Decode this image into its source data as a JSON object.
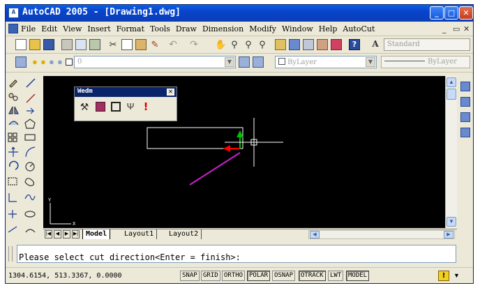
{
  "window": {
    "title": "AutoCAD 2005 - [Drawing1.dwg]",
    "app_icon_glyph": "A",
    "minimize_glyph": "_",
    "maximize_glyph": "□",
    "close_glyph": "✕"
  },
  "menubar": {
    "items": [
      "File",
      "Edit",
      "View",
      "Insert",
      "Format",
      "Tools",
      "Draw",
      "Dimension",
      "Modify",
      "Window",
      "Help",
      "AutoCut"
    ],
    "doc_controls": [
      "_",
      "▭",
      "✕"
    ]
  },
  "toolbar_standard": {
    "text_style_value": "Standard",
    "icons": [
      "new-icon",
      "open-icon",
      "save-icon",
      "plot-icon",
      "plot-preview-icon",
      "publish-icon",
      "cut-icon",
      "copy-icon",
      "paste-icon",
      "match-properties-icon",
      "undo-icon",
      "redo-icon",
      "pan-icon",
      "zoom-realtime-icon",
      "zoom-window-icon",
      "zoom-previous-icon",
      "properties-icon",
      "design-center-icon",
      "tool-palettes-icon",
      "sheet-set-icon",
      "markup-icon",
      "help-icon",
      "text-style-icon"
    ]
  },
  "toolbar_layers": {
    "layer_value": "0",
    "color_value": "ByLayer",
    "linetype_value": "ByLayer"
  },
  "floating_panel": {
    "title": "Wedm",
    "close_glyph": "✕",
    "icons": [
      "wire-path-icon",
      "square-tool-icon",
      "frame-tool-icon",
      "cutter-tool-icon",
      "alert-icon"
    ]
  },
  "layout_tabs": {
    "nav": [
      "|◀",
      "◀",
      "▶",
      "▶|"
    ],
    "tabs": [
      "Model",
      "Layout1",
      "Layout2"
    ],
    "active": "Model"
  },
  "ucs": {
    "y_label": "Y",
    "x_label": "X"
  },
  "command_line": {
    "text": "Please select cut direction<Enter = finish>:"
  },
  "status": {
    "coords": "1304.6154, 513.3367, 0.0000",
    "toggles": [
      {
        "label": "SNAP",
        "on": false
      },
      {
        "label": "GRID",
        "on": false
      },
      {
        "label": "ORTHO",
        "on": false
      },
      {
        "label": "POLAR",
        "on": true
      },
      {
        "label": "OSNAP",
        "on": false
      },
      {
        "label": "OTRACK",
        "on": true
      },
      {
        "label": "LWT",
        "on": false
      },
      {
        "label": "MODEL",
        "on": true
      }
    ]
  },
  "colors": {
    "canvas_bg": "#000000",
    "title_bar": "#0a4fd6",
    "arrow_green": "#00c000",
    "arrow_red": "#ff0000",
    "line_magenta": "#cc22cc",
    "geometry_white": "#ffffff"
  }
}
